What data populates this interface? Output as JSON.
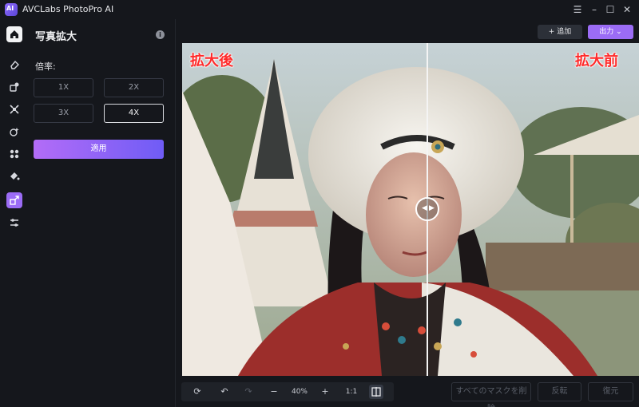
{
  "app": {
    "title": "AVCLabs PhotoPro AI",
    "logo_text": "AI"
  },
  "window": {
    "menu_icon": "menu-icon",
    "minimize_icon": "minimize-icon",
    "maximize_icon": "maximize-icon",
    "close_icon": "close-icon"
  },
  "rail": {
    "items": [
      {
        "name": "home",
        "icon": "home-icon",
        "active": true
      },
      {
        "name": "eraser",
        "icon": "eraser-icon"
      },
      {
        "name": "replace",
        "icon": "replace-icon"
      },
      {
        "name": "crop",
        "icon": "expand-icon"
      },
      {
        "name": "face",
        "icon": "face-magic-icon"
      },
      {
        "name": "background",
        "icon": "background-icon"
      },
      {
        "name": "color",
        "icon": "paint-bucket-icon"
      },
      {
        "name": "upscale",
        "icon": "upscale-icon",
        "selected": true
      },
      {
        "name": "adjust",
        "icon": "sliders-icon"
      }
    ]
  },
  "panel": {
    "title": "写真拡大",
    "scale_label": "倍率:",
    "scale_options": [
      "1X",
      "2X",
      "3X",
      "4X"
    ],
    "selected_scale": "4X",
    "apply_label": "適用"
  },
  "header": {
    "add_label": "+ 追加",
    "export_label": "出力",
    "export_icon": "chevron-down-icon"
  },
  "canvas": {
    "label_after": "拡大後",
    "label_before": "拡大前"
  },
  "toolbar": {
    "reset_icon": "reset-icon",
    "undo_icon": "undo-icon",
    "redo_icon": "redo-icon",
    "zoom_out": "−",
    "zoom_value": "40%",
    "zoom_in": "+",
    "fit_label": "1:1",
    "compare_icon": "split-compare-icon"
  },
  "actions": {
    "clear_masks_label": "すべてのマスクを削除",
    "invert_label": "反転",
    "restore_label": "復元"
  },
  "colors": {
    "accent": "#9b6cf5",
    "apply_gradient_start": "#b36cf7",
    "apply_gradient_end": "#6f5cf6",
    "label_red": "#ff2a2a"
  }
}
